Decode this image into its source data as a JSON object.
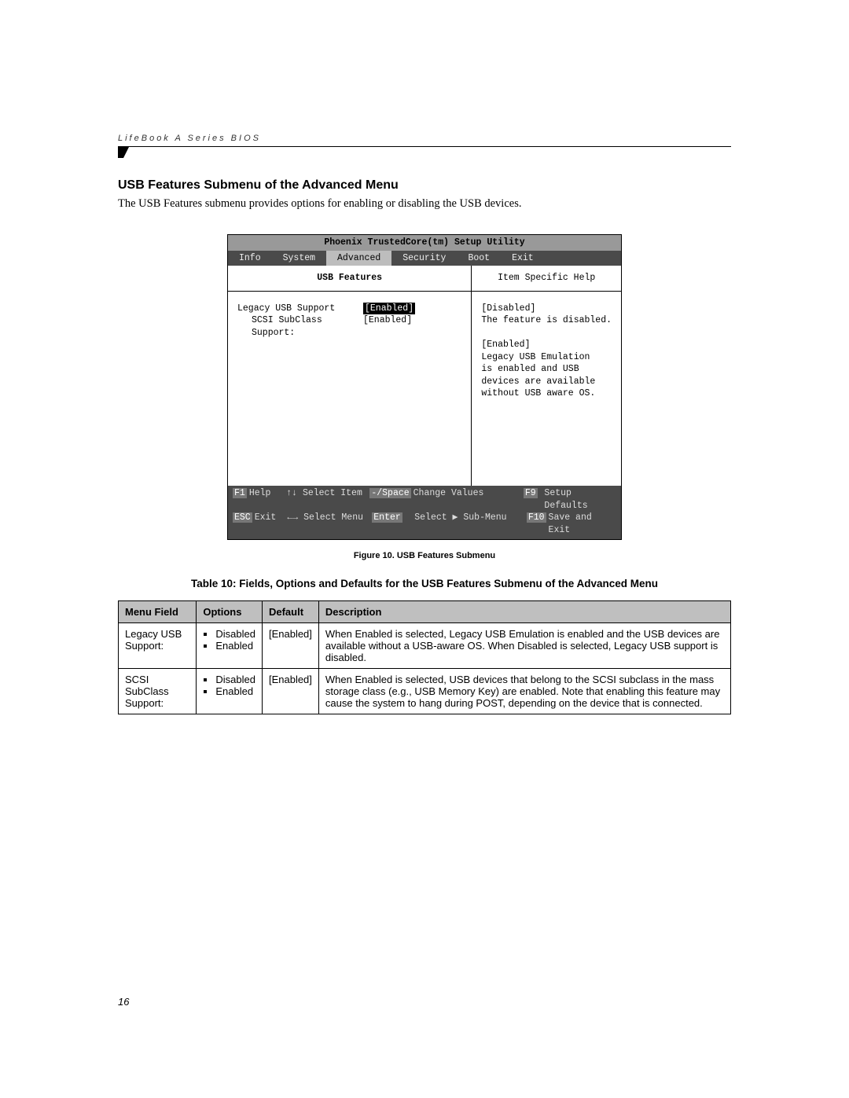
{
  "header": {
    "running_head": "LifeBook A Series BIOS"
  },
  "section": {
    "title": "USB Features Submenu of the Advanced Menu",
    "intro": "The USB Features submenu provides options for enabling or disabling the USB devices."
  },
  "bios": {
    "utility_title": "Phoenix TrustedCore(tm) Setup Utility",
    "tabs": [
      "Info",
      "System",
      "Advanced",
      "Security",
      "Boot",
      "Exit"
    ],
    "active_tab_index": 2,
    "left_heading": "USB Features",
    "right_heading": "Item Specific Help",
    "settings": [
      {
        "label": "Legacy USB Support",
        "value": "[Enabled]",
        "selected": true,
        "indent": false
      },
      {
        "label": "SCSI SubClass Support:",
        "value": "[Enabled]",
        "selected": false,
        "indent": true
      }
    ],
    "help_lines": [
      "[Disabled]",
      "The feature is disabled.",
      "",
      "[Enabled]",
      "Legacy USB Emulation",
      "is enabled and USB",
      "devices are available",
      "without USB aware OS."
    ],
    "keys": {
      "row1": {
        "a_key": "F1",
        "a_label": "Help",
        "b_sym": "↑↓",
        "b_label": "Select Item",
        "c_key": "-/Space",
        "c_label": "Change Values",
        "d_key": "F9",
        "d_label": "Setup Defaults"
      },
      "row2": {
        "a_key": "ESC",
        "a_label": "Exit",
        "b_sym": "←→",
        "b_label": "Select Menu",
        "c_key": "Enter",
        "c_label": "Select ▶ Sub-Menu",
        "d_key": "F10",
        "d_label": "Save and Exit"
      }
    }
  },
  "figure_caption": "Figure 10.  USB Features Submenu",
  "table_caption": "Table 10: Fields, Options and Defaults for the USB Features Submenu of the Advanced Menu",
  "table": {
    "headers": [
      "Menu Field",
      "Options",
      "Default",
      "Description"
    ],
    "rows": [
      {
        "field": "Legacy USB Support:",
        "options": [
          "Disabled",
          "Enabled"
        ],
        "default": "[Enabled]",
        "description": "When Enabled is selected, Legacy USB Emulation is enabled and the USB devices are available without a USB-aware OS. When Disabled is selected, Legacy USB support is disabled."
      },
      {
        "field": "SCSI SubClass Support:",
        "options": [
          "Disabled",
          "Enabled"
        ],
        "default": "[Enabled]",
        "description": "When Enabled is selected, USB devices that belong to the SCSI subclass in the mass storage class (e.g., USB Memory Key) are enabled. Note that enabling this feature may cause the system to hang during POST, depending on the device that is connected."
      }
    ]
  },
  "page_number": "16"
}
